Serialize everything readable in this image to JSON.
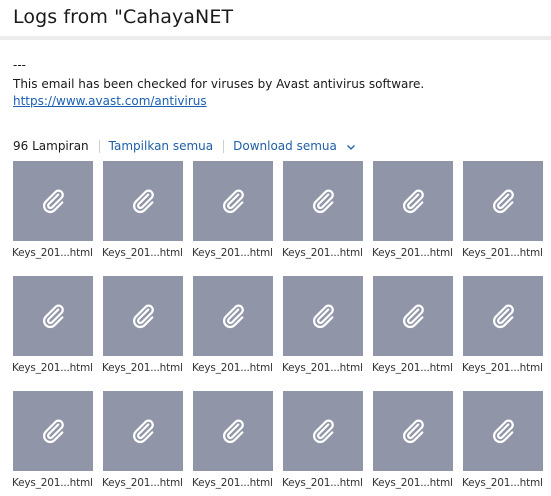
{
  "header": {
    "title": "Logs from \"CahayaNET"
  },
  "message": {
    "signature_dashes": "---",
    "signature_text": "This email has been checked for viruses by Avast antivirus software.",
    "signature_link": "https://www.avast.com/antivirus"
  },
  "attachments": {
    "count_label": "96 Lampiran",
    "show_all_label": "Tampilkan semua",
    "download_all_label": "Download semua",
    "items": [
      {
        "name": "Keys_201...html",
        "icon": "paperclip-icon"
      },
      {
        "name": "Keys_201...html",
        "icon": "paperclip-icon"
      },
      {
        "name": "Keys_201...html",
        "icon": "paperclip-icon"
      },
      {
        "name": "Keys_201...html",
        "icon": "paperclip-icon"
      },
      {
        "name": "Keys_201...html",
        "icon": "paperclip-icon"
      },
      {
        "name": "Keys_201...html",
        "icon": "paperclip-icon"
      },
      {
        "name": "Keys_201...html",
        "icon": "paperclip-icon"
      },
      {
        "name": "Keys_201...html",
        "icon": "paperclip-icon"
      },
      {
        "name": "Keys_201...html",
        "icon": "paperclip-icon"
      },
      {
        "name": "Keys_201...html",
        "icon": "paperclip-icon"
      },
      {
        "name": "Keys_201...html",
        "icon": "paperclip-icon"
      },
      {
        "name": "Keys_201...html",
        "icon": "paperclip-icon"
      },
      {
        "name": "Keys_201...html",
        "icon": "paperclip-icon"
      },
      {
        "name": "Keys_201...html",
        "icon": "paperclip-icon"
      },
      {
        "name": "Keys_201...html",
        "icon": "paperclip-icon"
      },
      {
        "name": "Keys_201...html",
        "icon": "paperclip-icon"
      },
      {
        "name": "Keys_201...html",
        "icon": "paperclip-icon"
      },
      {
        "name": "Keys_201...html",
        "icon": "paperclip-icon"
      }
    ]
  },
  "colors": {
    "tile_background": "#9096a8",
    "link": "#1f5fa8",
    "header_rule": "#ececec"
  }
}
